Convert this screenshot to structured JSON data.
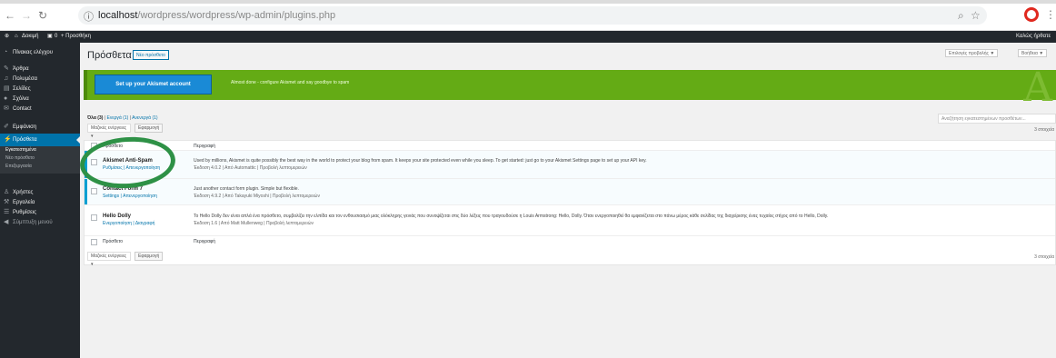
{
  "browser": {
    "url_host": "localhost",
    "url_path": "/wordpress/wordpress/wp-admin/plugins.php",
    "info_icon": "ⓘ"
  },
  "adminbar": {
    "site_name": "Δοκιμή",
    "comments": "0",
    "new_label": "+ Προσθήκη",
    "greeting": "Καλώς ήρθατε"
  },
  "sidebar": {
    "items": [
      {
        "label": "Πίνακας ελέγχου",
        "icon": "dashboard-icon"
      },
      {
        "label": "Άρθρα",
        "icon": "pin-icon"
      },
      {
        "label": "Πολυμέσα",
        "icon": "media-icon"
      },
      {
        "label": "Σελίδες",
        "icon": "page-icon"
      },
      {
        "label": "Σχόλια",
        "icon": "comment-icon"
      },
      {
        "label": "Contact",
        "icon": "mail-icon"
      },
      {
        "label": "Εμφάνιση",
        "icon": "brush-icon"
      },
      {
        "label": "Πρόσθετα",
        "icon": "plugin-icon"
      },
      {
        "label": "Χρήστες",
        "icon": "user-icon"
      },
      {
        "label": "Εργαλεία",
        "icon": "wrench-icon"
      },
      {
        "label": "Ρυθμίσεις",
        "icon": "settings-icon"
      },
      {
        "label": "Σύμπτυξη μενού",
        "icon": "collapse-icon"
      }
    ],
    "submenu": [
      "Εγκατεστημένα",
      "Νέο πρόσθετο",
      "Επεξεργασία"
    ]
  },
  "header": {
    "title": "Πρόσθετα",
    "add_new": "Νέο πρόσθετο",
    "screen_options": "Επιλογές προβολής ▼",
    "help": "Βοήθεια ▼"
  },
  "banner": {
    "button": "Set up your Akismet account",
    "text": "Almost done - configure Akismet and say goodbye to spam",
    "logo": "A",
    "accent": "#64ab15"
  },
  "filters": {
    "all": "Όλα (3)",
    "sep1": " | ",
    "inactive": "Ενεργά (1)",
    "sep2": " | ",
    "active": "Ανενεργά (1)",
    "bulk_select": "Μαζικές ενέργειες",
    "apply": "Εφαρμογή",
    "search_placeholder": "Αναζήτηση εγκατεστημένων προσθέτων...",
    "count": "3 στοιχεία"
  },
  "table": {
    "col_plugin": "Πρόσθετο",
    "col_desc": "Περιγραφή",
    "plugins": [
      {
        "name": "Akismet Anti-Spam",
        "actions": "Ρυθμίσεις | Απενεργοποίηση",
        "desc": "Used by millions, Akismet is quite possibly the best way in the world to protect your blog from spam. It keeps your site protected even while you sleep. To get started: just go to your Akismet Settings page to set up your API key.",
        "meta": "Έκδοση 4.0.2 | Από Automattic | Προβολή λεπτομερειών"
      },
      {
        "name": "Contact Form 7",
        "actions": "Settings | Απενεργοποίηση",
        "desc": "Just another contact form plugin. Simple but flexible.",
        "meta": "Έκδοση 4.9.2 | Από Takayuki Miyoshi | Προβολή λεπτομερειών"
      },
      {
        "name": "Hello Dolly",
        "actions": "Ενεργοποίηση | Διαγραφή",
        "desc": "Το Hello Dolly δεν είναι απλά ένα πρόσθετο, συμβολίζει την ελπίδα και τον ενθουσιασμό μιας ολόκληρης γενιάς που συνοψίζεται στις δύο λέξεις που τραγουδούσε η Louis Armstrong: Hello, Dolly. Όταν ενεργοποιηθεί θα εμφανίζεται στο πάνω μέρος κάθε σελίδας της διαχείρισης ένας τυχαίος στίχος από το Hello, Dolly.",
        "meta": "Έκδοση 1.6 | Από Matt Mullenweg | Προβολή λεπτομερειών"
      }
    ]
  }
}
